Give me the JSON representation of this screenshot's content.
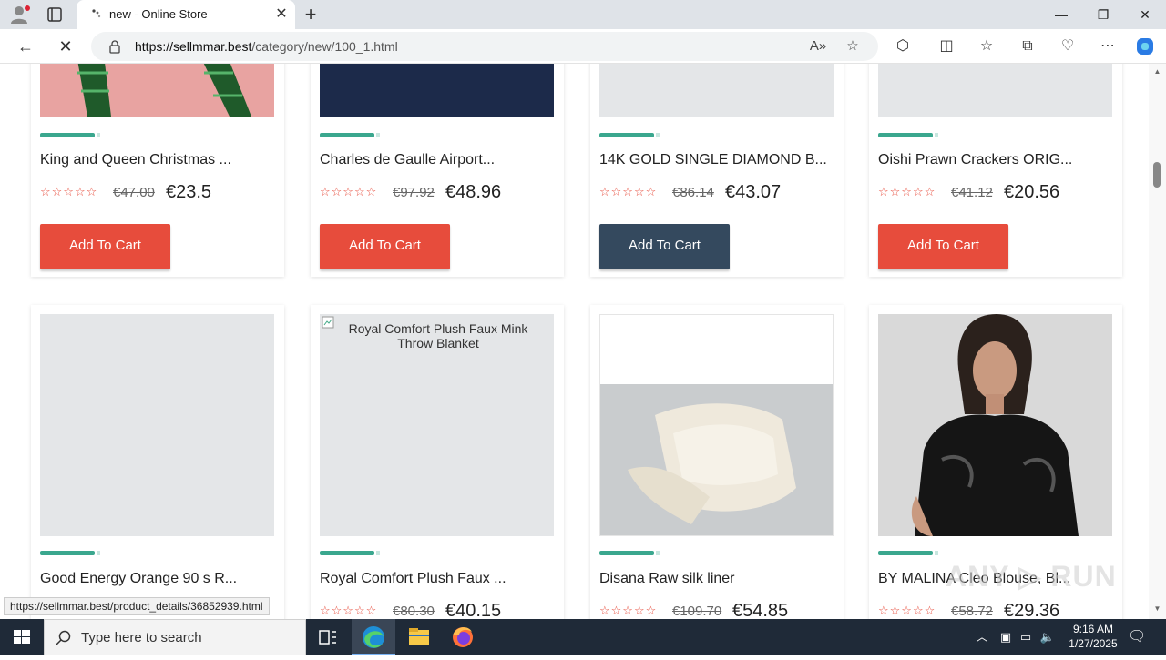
{
  "browser": {
    "tab_title": "new - Online Store",
    "url_domain": "https://sellmmar.best",
    "url_path": "/category/new/100_1.html",
    "status_url": "https://sellmmar.best/product_details/36852939.html"
  },
  "products": [
    {
      "name": "King and Queen Christmas ...",
      "stars": "☆☆☆☆☆",
      "old_price": "€47.00",
      "price": "€23.5",
      "cart_label": "Add To Cart"
    },
    {
      "name": "Charles de Gaulle Airport...",
      "stars": "☆☆☆☆☆",
      "old_price": "€97.92",
      "price": "€48.96",
      "cart_label": "Add To Cart"
    },
    {
      "name": "14K GOLD SINGLE DIAMOND B...",
      "stars": "☆☆☆☆☆",
      "old_price": "€86.14",
      "price": "€43.07",
      "cart_label": "Add To Cart"
    },
    {
      "name": "Oishi Prawn Crackers ORIG...",
      "stars": "☆☆☆☆☆",
      "old_price": "€41.12",
      "price": "€20.56",
      "cart_label": "Add To Cart"
    },
    {
      "name": "Good Energy Orange 90 s R...",
      "stars": "☆☆☆☆☆",
      "old_price": "",
      "price": ""
    },
    {
      "name": "Royal Comfort Plush Faux ...",
      "stars": "☆☆☆☆☆",
      "old_price": "€80.30",
      "price": "€40.15",
      "img_alt": "Royal Comfort Plush Faux Mink Throw Blanket"
    },
    {
      "name": "Disana Raw silk liner",
      "stars": "☆☆☆☆☆",
      "old_price": "€109.70",
      "price": "€54.85"
    },
    {
      "name": "BY MALINA Cleo Blouse, Bl...",
      "stars": "☆☆☆☆☆",
      "old_price": "€58.72",
      "price": "€29.36"
    }
  ],
  "taskbar": {
    "search_placeholder": "Type here to search",
    "time": "9:16 AM",
    "date": "1/27/2025"
  },
  "watermark": "ANY RUN",
  "colors": {
    "accent_bar": "#3aa78e",
    "cart_button": "#e74c3c",
    "cart_button_hover": "#34495e",
    "stars": "#e74c3c"
  }
}
